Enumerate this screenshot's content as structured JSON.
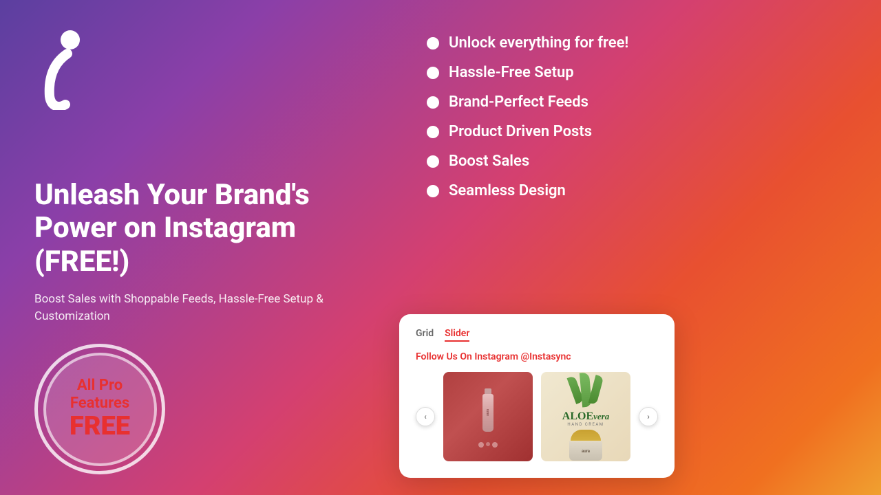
{
  "background": {
    "gradient_desc": "purple to pink to red to orange gradient"
  },
  "logo": {
    "alt": "Instasync logo"
  },
  "hero": {
    "title": "Unleash Your Brand's Power on Instagram (FREE!)",
    "subtitle": "Boost Sales with Shoppable Feeds, Hassle-Free Setup & Customization"
  },
  "badge": {
    "line1": "All Pro",
    "line2": "Features",
    "line3": "FREE"
  },
  "features": [
    {
      "id": 1,
      "text": "Unlock everything for free!"
    },
    {
      "id": 2,
      "text": "Hassle-Free Setup"
    },
    {
      "id": 3,
      "text": "Brand-Perfect Feeds"
    },
    {
      "id": 4,
      "text": "Product Driven Posts"
    },
    {
      "id": 5,
      "text": "Boost Sales"
    },
    {
      "id": 6,
      "text": "Seamless Design"
    }
  ],
  "widget": {
    "tab_grid": "Grid",
    "tab_slider": "Slider",
    "tab_slider_active": true,
    "follow_text": "Follow Us On Instagram",
    "handle": "@Instasync",
    "nav_prev": "‹",
    "nav_next": "›",
    "product1_brand": "aura",
    "product2_title": "ALOE",
    "product2_italic": "vera",
    "product2_sub": "HAND CREAM",
    "product2_brand": "aura",
    "product2_type": "Cream"
  }
}
